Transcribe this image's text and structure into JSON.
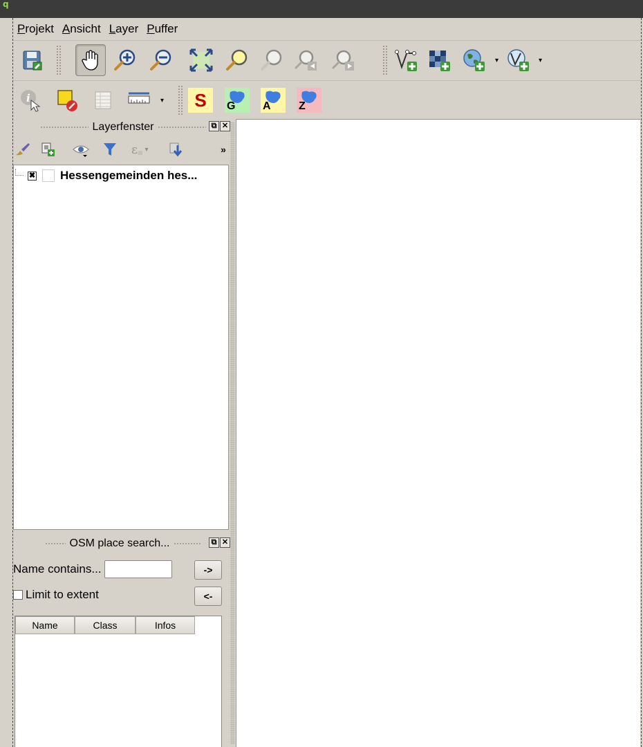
{
  "menubar": {
    "items": [
      {
        "label": "Projekt"
      },
      {
        "label": "Ansicht"
      },
      {
        "label": "Layer"
      },
      {
        "label": "Puffer"
      }
    ]
  },
  "toolbar1": {
    "icons": [
      "save-project-icon",
      "pan-hand-icon",
      "zoom-in-icon",
      "zoom-out-icon",
      "zoom-full-icon",
      "zoom-to-selection-icon",
      "zoom-to-layer-icon",
      "zoom-last-icon",
      "zoom-next-icon",
      "add-vector-layer-icon",
      "add-raster-layer-icon",
      "add-wms-layer-icon",
      "add-wfs-layer-icon"
    ]
  },
  "toolbar2": {
    "icons": [
      "identify-features-icon",
      "deselect-features-icon",
      "attribute-table-icon",
      "measure-line-icon"
    ],
    "plugin_buttons": [
      {
        "label": "S",
        "bg": "#fff6a8",
        "color": "#c00000"
      },
      {
        "label": "G",
        "bg": "#b7f0b2",
        "color": "#000000"
      },
      {
        "label": "A",
        "bg": "#fff6a8",
        "color": "#000000"
      },
      {
        "label": "Z",
        "bg": "#f5b9c0",
        "color": "#000000"
      }
    ]
  },
  "layer_panel": {
    "title": "Layerfenster",
    "layers": [
      {
        "name": "Hessengemeinden hes...",
        "checked": true
      }
    ]
  },
  "osm_panel": {
    "title": "OSM place search...",
    "name_label": "Name contains...",
    "name_value": "",
    "go_button": "->",
    "limit_label": "Limit to extent",
    "back_button": "<-",
    "columns": [
      "Name",
      "Class",
      "Infos"
    ]
  },
  "colors": {
    "window_bg": "#d6d2c9",
    "titlebar": "#3b3b3b",
    "map_bg": "#ffffff"
  }
}
